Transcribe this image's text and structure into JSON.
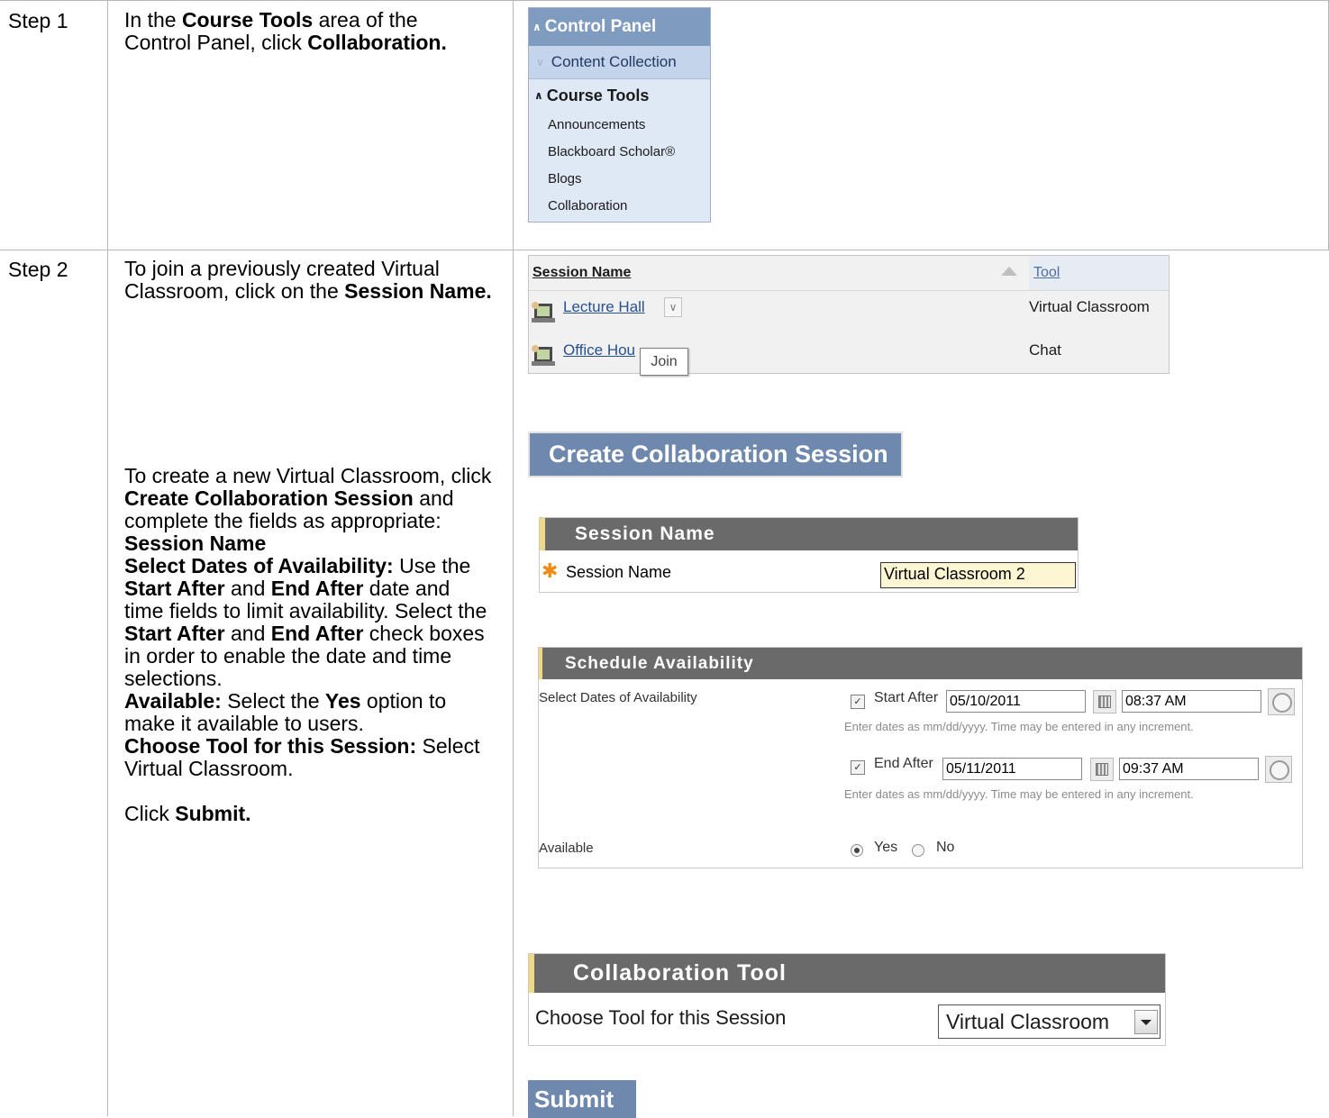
{
  "steps": [
    {
      "label": "Step 1"
    },
    {
      "label": "Step 2"
    }
  ],
  "step1": {
    "pre": "In the ",
    "bold1": "Course Tools",
    "mid": " area of the Control Panel, click ",
    "bold2": "Collaboration."
  },
  "step2a": {
    "pre": "To join a previously created Virtual Classroom, click on the ",
    "bold": "Session Name."
  },
  "step2b": {
    "pre": "To create a new Virtual Classroom, click ",
    "bold1": "Create Collaboration Session",
    "post1": " and complete the fields as appropriate:",
    "session_name": "Session Name",
    "sel_dates": "Select Dates of Availability:",
    "use_the": " Use the ",
    "start_after": "Start After",
    "and": " and ",
    "end_after": "End After",
    "date_time": " date and time fields to limit availability. Select the ",
    "start_after2": "Start After",
    "and2": " and ",
    "end_after2": "End After",
    "check_text": " check boxes in order to enable the date and time selections.",
    "available": "Available:",
    "avail_text": " Select the ",
    "yes": "Yes",
    "avail_text2": " option to make it available to users.",
    "choose_tool": "Choose Tool for this Session:",
    "choose_text": " Select Virtual Classroom.",
    "click": "Click ",
    "submit": "Submit."
  },
  "control_panel": {
    "title": "Control Panel",
    "content_collection": "Content Collection",
    "course_tools": "Course Tools",
    "items": [
      "Announcements",
      "Blackboard Scholar®",
      "Blogs",
      "Collaboration"
    ]
  },
  "session_list": {
    "col_name": "Session Name",
    "col_tool": "Tool",
    "rows": [
      {
        "name": "Lecture Hall",
        "tool": "Virtual Classroom"
      },
      {
        "name": "Office Hou",
        "tool": "Chat"
      }
    ],
    "tooltip": "Join"
  },
  "create_button": "Create Collaboration Session",
  "session_name_panel": {
    "header": "Session Name",
    "label": "Session Name",
    "value": "Virtual Classroom 2"
  },
  "schedule_panel": {
    "header": "Schedule Availability",
    "dates_label": "Select Dates of Availability",
    "start_label": "Start After",
    "start_date": "05/10/2011",
    "start_time": "08:37 AM",
    "end_label": "End After",
    "end_date": "05/11/2011",
    "end_time": "09:37 AM",
    "helper": "Enter dates as mm/dd/yyyy. Time may be entered in any increment.",
    "available_label": "Available",
    "yes": "Yes",
    "no": "No"
  },
  "tool_panel": {
    "header": "Collaboration Tool",
    "label": "Choose Tool for this Session",
    "selected": "Virtual Classroom"
  },
  "submit_button": "Submit"
}
